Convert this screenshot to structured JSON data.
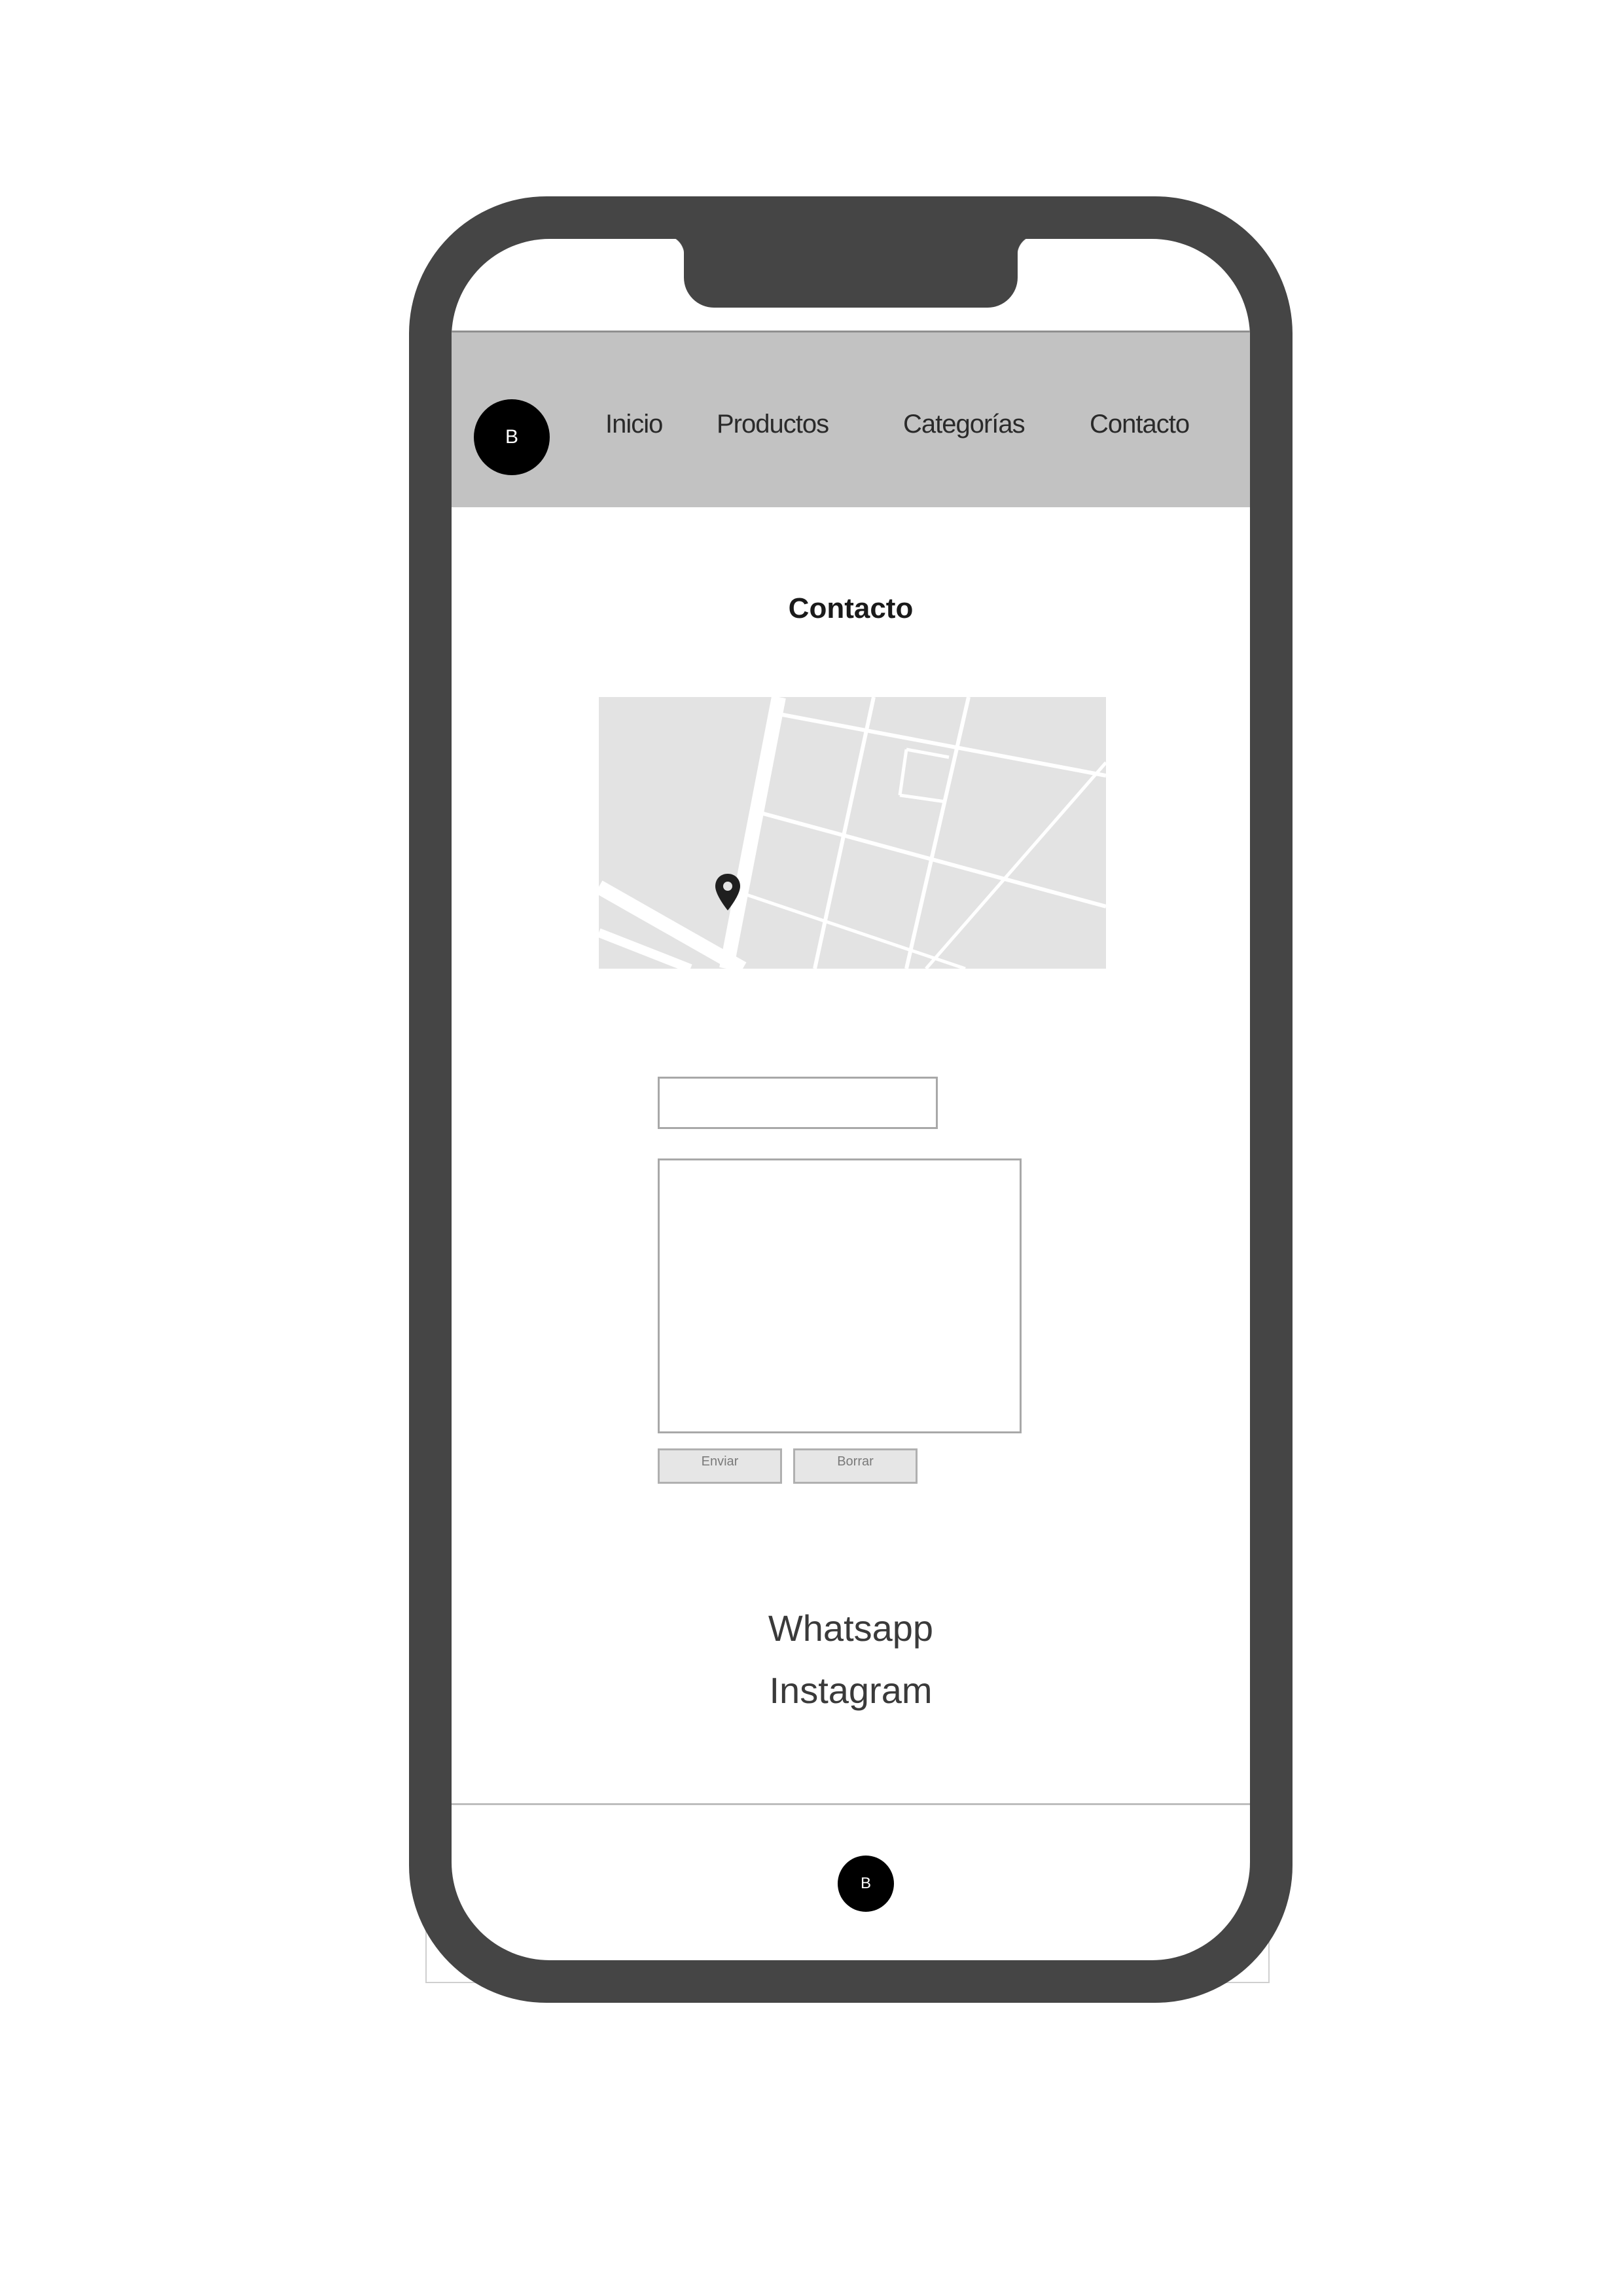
{
  "brand": {
    "logo_text": "B"
  },
  "nav": {
    "items": [
      {
        "label": "Inicio"
      },
      {
        "label": "Productos"
      },
      {
        "label": "Categorías"
      },
      {
        "label": "Contacto"
      }
    ]
  },
  "main": {
    "title": "Contacto"
  },
  "map": {
    "icon": "map-pin-icon"
  },
  "form": {
    "name_value": "",
    "message_value": "",
    "send_label": "Enviar",
    "clear_label": "Borrar"
  },
  "social": {
    "links": [
      {
        "label": "Whatsapp"
      },
      {
        "label": "Instagram"
      }
    ]
  },
  "footer": {
    "logo_text": "B"
  },
  "colors": {
    "phone_frame": "#454545",
    "navbar": "#c2c2c2",
    "map_background": "#e3e3e3",
    "logo": "#000000"
  }
}
